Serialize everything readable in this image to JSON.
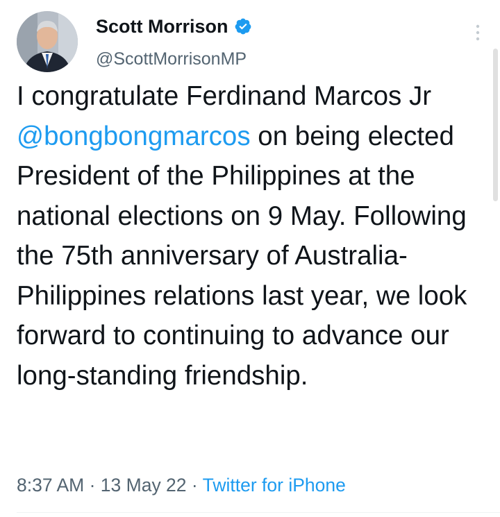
{
  "author": {
    "display_name": "Scott Morrison",
    "handle": "@ScottMorrisonMP",
    "verified": true
  },
  "tweet": {
    "text_before_mention": "I congratulate Ferdinand Marcos Jr ",
    "mention": "@bongbongmarcos",
    "text_after_mention": " on being elected President of the Philippines at the national elections on 9 May. Following the 75th anniversary of Australia-Philippines relations last year, we look forward to continuing to advance our long-standing friendship."
  },
  "meta": {
    "time": "8:37 AM",
    "separator": " · ",
    "date": "13 May 22",
    "source": "Twitter for iPhone"
  },
  "icons": {
    "verified": "verified-badge-icon",
    "more": "more-vertical-icon"
  },
  "colors": {
    "link": "#1d9bf0",
    "secondary_text": "#536471",
    "primary_text": "#0f1419"
  }
}
